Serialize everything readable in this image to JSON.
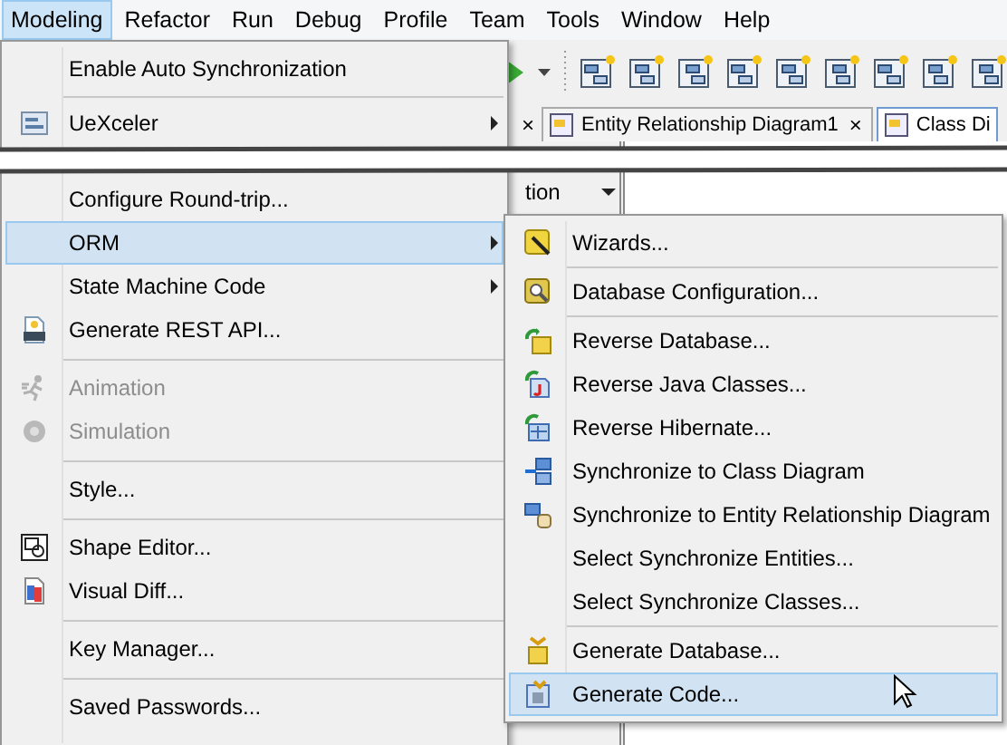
{
  "menubar": [
    {
      "label": "Modeling",
      "selected": true
    },
    {
      "label": "Refactor",
      "selected": false
    },
    {
      "label": "Run",
      "selected": false
    },
    {
      "label": "Debug",
      "selected": false
    },
    {
      "label": "Profile",
      "selected": false
    },
    {
      "label": "Team",
      "selected": false
    },
    {
      "label": "Tools",
      "selected": false
    },
    {
      "label": "Window",
      "selected": false
    },
    {
      "label": "Help",
      "selected": false
    }
  ],
  "tab_strip": {
    "close": "×",
    "tabs": [
      {
        "label": "Entity Relationship Diagram1",
        "close": "×",
        "selected": false
      },
      {
        "label": "Class Di",
        "selected": true
      }
    ]
  },
  "side_panel": {
    "field": "tion"
  },
  "modeling_menu": {
    "items_above_break": [
      {
        "kind": "item",
        "label": "Enable Auto Synchronization",
        "selected": false,
        "disabled": false,
        "submenu": false
      },
      {
        "kind": "separator"
      },
      {
        "kind": "item",
        "label": "UeXceler",
        "selected": false,
        "disabled": false,
        "submenu": true
      }
    ],
    "items_below_break": [
      {
        "kind": "item",
        "label": "Configure Round-trip...",
        "selected": false,
        "disabled": false,
        "submenu": false
      },
      {
        "kind": "item",
        "label": "ORM",
        "selected": true,
        "disabled": false,
        "submenu": true
      },
      {
        "kind": "item",
        "label": "State Machine Code",
        "selected": false,
        "disabled": false,
        "submenu": true
      },
      {
        "kind": "item",
        "label": "Generate REST API...",
        "selected": false,
        "disabled": false,
        "submenu": false
      },
      {
        "kind": "separator"
      },
      {
        "kind": "item",
        "label": "Animation",
        "selected": false,
        "disabled": true,
        "submenu": false
      },
      {
        "kind": "item",
        "label": "Simulation",
        "selected": false,
        "disabled": true,
        "submenu": false
      },
      {
        "kind": "separator"
      },
      {
        "kind": "item",
        "label": "Style...",
        "selected": false,
        "disabled": false,
        "submenu": false
      },
      {
        "kind": "separator"
      },
      {
        "kind": "item",
        "label": "Shape Editor...",
        "selected": false,
        "disabled": false,
        "submenu": false
      },
      {
        "kind": "item",
        "label": "Visual Diff...",
        "selected": false,
        "disabled": false,
        "submenu": false
      },
      {
        "kind": "separator"
      },
      {
        "kind": "item",
        "label": "Key Manager...",
        "selected": false,
        "disabled": false,
        "submenu": false
      },
      {
        "kind": "separator"
      },
      {
        "kind": "item",
        "label": "Saved Passwords...",
        "selected": false,
        "disabled": false,
        "submenu": false
      }
    ]
  },
  "orm_submenu": {
    "items": [
      {
        "kind": "item",
        "label": "Wizards...",
        "selected": false
      },
      {
        "kind": "separator"
      },
      {
        "kind": "item",
        "label": "Database Configuration...",
        "selected": false
      },
      {
        "kind": "separator"
      },
      {
        "kind": "item",
        "label": "Reverse Database...",
        "selected": false
      },
      {
        "kind": "item",
        "label": "Reverse Java Classes...",
        "selected": false
      },
      {
        "kind": "item",
        "label": "Reverse Hibernate...",
        "selected": false
      },
      {
        "kind": "item",
        "label": "Synchronize to Class Diagram",
        "selected": false
      },
      {
        "kind": "item",
        "label": "Synchronize to Entity Relationship Diagram",
        "selected": false
      },
      {
        "kind": "item",
        "label": "Select Synchronize Entities...",
        "selected": false
      },
      {
        "kind": "item",
        "label": "Select Synchronize Classes...",
        "selected": false
      },
      {
        "kind": "separator"
      },
      {
        "kind": "item",
        "label": "Generate Database...",
        "selected": false
      },
      {
        "kind": "item",
        "label": "Generate Code...",
        "selected": true
      }
    ]
  }
}
